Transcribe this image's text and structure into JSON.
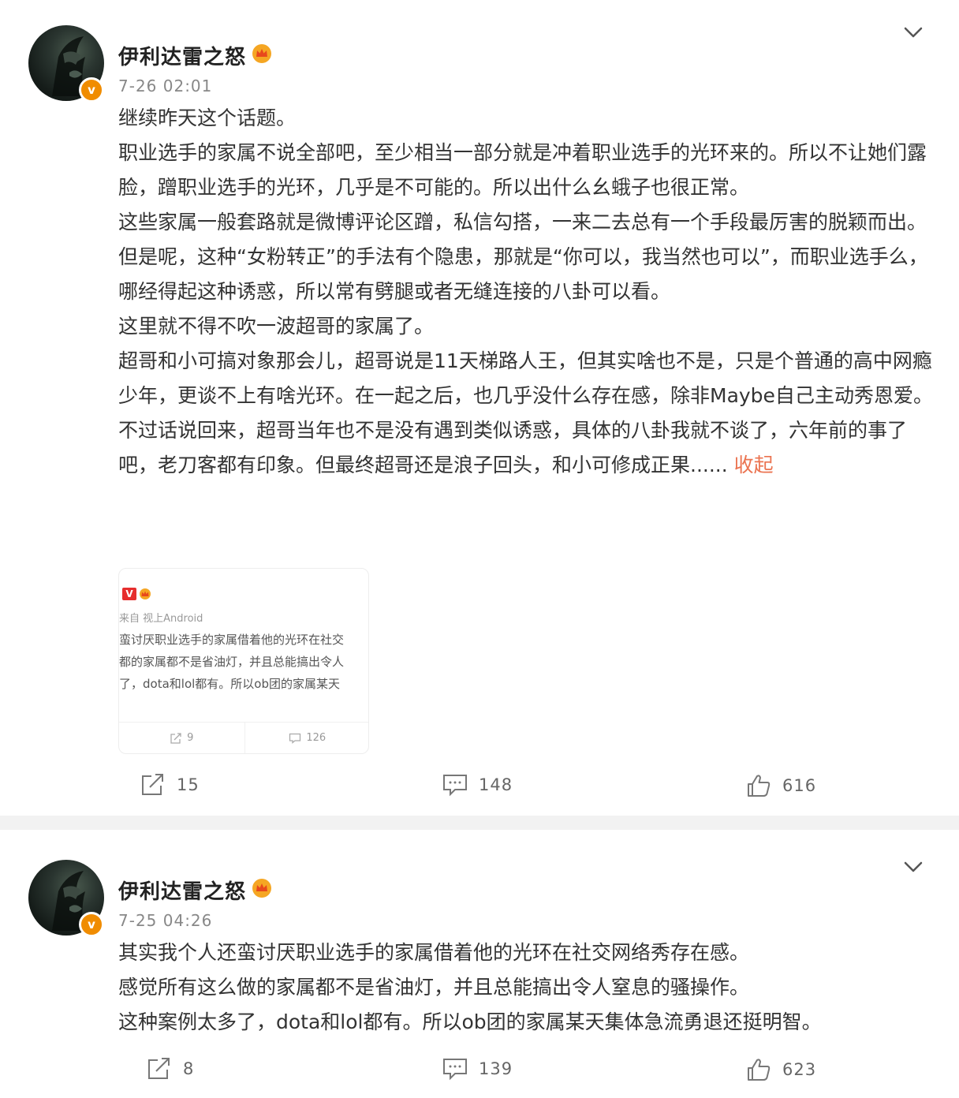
{
  "posts": [
    {
      "username": "伊利达雷之怒",
      "verified_badge": "v",
      "timestamp": "7-26 02:01",
      "paragraphs": [
        "继续昨天这个话题。",
        "职业选手的家属不说全部吧，至少相当一部分就是冲着职业选手的光环来的。所以不让她们露脸，蹭职业选手的光环，几乎是不可能的。所以出什么幺蛾子也很正常。",
        "这些家属一般套路就是微博评论区蹭，私信勾搭，一来二去总有一个手段最厉害的脱颖而出。",
        "但是呢，这种“女粉转正”的手法有个隐患，那就是“你可以，我当然也可以”，而职业选手么，哪经得起这种诱惑，所以常有劈腿或者无缝连接的八卦可以看。",
        "这里就不得不吹一波超哥的家属了。",
        "超哥和小可搞对象那会儿，超哥说是11天梯路人王，但其实啥也不是，只是个普通的高中网瘾少年，更谈不上有啥光环。在一起之后，也几乎没什么存在感，除非Maybe自己主动秀恩爱。",
        "不过话说回来，超哥当年也不是没有遇到类似诱惑，具体的八卦我就不谈了，六年前的事了吧，老刀客都有印象。但最终超哥还是浪子回头，和小可修成正果......"
      ],
      "collapse_label": "收起",
      "embed": {
        "badge": "V",
        "source": "来自 视上Android",
        "lines": [
          "蛮讨厌职业选手的家属借着他的光环在社交",
          "都的家属都不是省油灯，并且总能搞出令人",
          "了，dota和lol都有。所以ob团的家属某天"
        ],
        "repost_count": "9",
        "comment_count": "126"
      },
      "repost_count": "15",
      "comment_count": "148",
      "like_count": "616"
    },
    {
      "username": "伊利达雷之怒",
      "verified_badge": "v",
      "timestamp": "7-25 04:26",
      "paragraphs": [
        "其实我个人还蛮讨厌职业选手的家属借着他的光环在社交网络秀存在感。",
        "感觉所有这么做的家属都不是省油灯，并且总能搞出令人窒息的骚操作。",
        "这种案例太多了，dota和lol都有。所以ob团的家属某天集体急流勇退还挺明智。"
      ],
      "repost_count": "8",
      "comment_count": "139",
      "like_count": "623"
    }
  ],
  "colors": {
    "accent_orange": "#eb7350",
    "verified_orange": "#f08c00",
    "text": "#333333",
    "muted": "#888888",
    "page_bg": "#f2f2f2"
  }
}
